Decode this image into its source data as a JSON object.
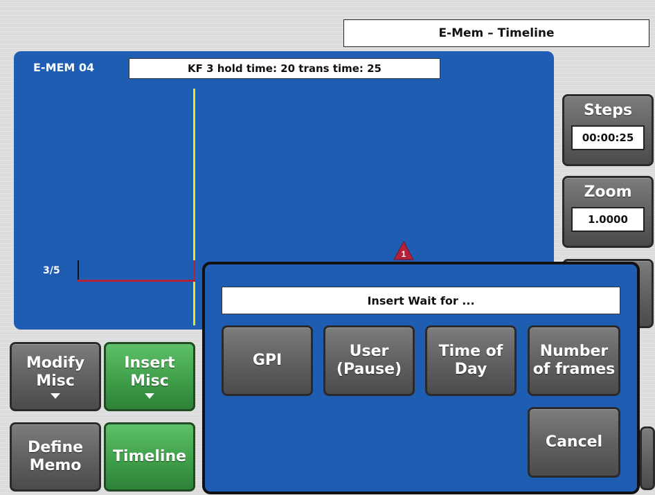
{
  "header": {
    "title": "E-Mem – Timeline"
  },
  "emem": {
    "name": "E-MEM 04",
    "keyframe_info": "KF 3 hold time: 20 trans time: 25",
    "track_label": "3/5",
    "marker_label": "1",
    "marker_color": "#b3223a",
    "cursor_color": "#e9e325"
  },
  "side": {
    "steps_label": "Steps",
    "steps_value": "00:00:25",
    "zoom_label": "Zoom",
    "zoom_value": "1.0000"
  },
  "bottom": {
    "modify_misc": [
      "Modify",
      "Misc"
    ],
    "insert_misc": [
      "Insert",
      "Misc"
    ],
    "define_memo": [
      "Define",
      "Memo"
    ],
    "timeline": "Timeline"
  },
  "dialog": {
    "title": "Insert Wait for ...",
    "gpi": "GPI",
    "user_pause": [
      "User",
      "(Pause)"
    ],
    "time_of_day": [
      "Time of",
      "Day"
    ],
    "number_of_frames": [
      "Number",
      "of frames"
    ],
    "cancel": "Cancel"
  },
  "colors": {
    "panel_blue": "#1f5db3",
    "button_gray": "#5f5f5f",
    "button_green": "#3f9f4a"
  }
}
